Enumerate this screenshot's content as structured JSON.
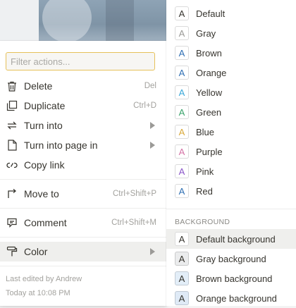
{
  "filter": {
    "placeholder": "Filter actions..."
  },
  "menu": {
    "group1": [
      {
        "label": "Delete",
        "shortcut": "Del",
        "icon": "trash-icon"
      },
      {
        "label": "Duplicate",
        "shortcut": "Ctrl+D",
        "icon": "duplicate-icon"
      },
      {
        "label": "Turn into",
        "shortcut": "",
        "icon": "turn-into-icon"
      },
      {
        "label": "Turn into page in",
        "shortcut": "",
        "icon": "page-icon"
      },
      {
        "label": "Copy link",
        "shortcut": "",
        "icon": "link-icon"
      }
    ],
    "move_to": {
      "label": "Move to",
      "shortcut": "Ctrl+Shift+P"
    },
    "comment": {
      "label": "Comment",
      "shortcut": "Ctrl+Shift+M"
    },
    "color": {
      "label": "Color"
    }
  },
  "footer": {
    "edited_by": "Last edited by Andrew",
    "edited_time": "Today at 10:08 PM"
  },
  "colors": {
    "text": [
      {
        "label": "Default",
        "color": "#37352f"
      },
      {
        "label": "Gray",
        "color": "#9b9a97"
      },
      {
        "label": "Brown",
        "color": "#2f6fb3"
      },
      {
        "label": "Orange",
        "color": "#2f6fb3"
      },
      {
        "label": "Yellow",
        "color": "#3aa7d8"
      },
      {
        "label": "Green",
        "color": "#3aa36b"
      },
      {
        "label": "Blue",
        "color": "#d9a83a"
      },
      {
        "label": "Purple",
        "color": "#d472a6"
      },
      {
        "label": "Pink",
        "color": "#8a55c8"
      },
      {
        "label": "Red",
        "color": "#2f6fb3"
      }
    ],
    "background_heading": "BACKGROUND",
    "background": [
      {
        "label": "Default background",
        "bg": "#ffffff",
        "color": "#37352f"
      },
      {
        "label": "Gray background",
        "bg": "#ebeced",
        "color": "#37352f"
      },
      {
        "label": "Brown background",
        "bg": "#e3eef8",
        "color": "#37352f"
      },
      {
        "label": "Orange background",
        "bg": "#dfeaf6",
        "color": "#37352f"
      }
    ],
    "swatch_letter": "A"
  }
}
